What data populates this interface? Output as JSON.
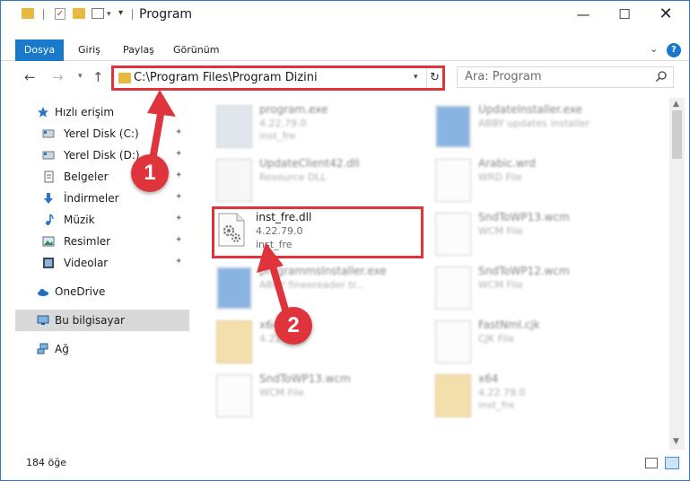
{
  "window": {
    "title": "Program",
    "minimize": "—",
    "maximize": "☐",
    "close": "✕"
  },
  "ribbon": {
    "tabs": [
      "Dosya",
      "Giriş",
      "Paylaş",
      "Görünüm"
    ],
    "help": "?",
    "expand": "⌄"
  },
  "nav": {
    "back": "←",
    "forward": "→",
    "recent": "▾",
    "up": "↑",
    "address": "C:\\Program Files\\Program Dizini",
    "address_dropdown": "▾",
    "refresh": "↻",
    "search_placeholder": "Ara: Program"
  },
  "sidebar": {
    "items": [
      {
        "label": "Hızlı erişim",
        "icon": "star-icon"
      },
      {
        "label": "Yerel Disk (C:)",
        "icon": "drive-icon",
        "pinned": true
      },
      {
        "label": "Yerel Disk (D:)",
        "icon": "drive-icon",
        "pinned": true
      },
      {
        "label": "Belgeler",
        "icon": "documents-icon",
        "pinned": true
      },
      {
        "label": "İndirmeler",
        "icon": "download-icon",
        "pinned": true
      },
      {
        "label": "Müzik",
        "icon": "music-icon",
        "pinned": true
      },
      {
        "label": "Resimler",
        "icon": "pictures-icon",
        "pinned": true
      },
      {
        "label": "Videolar",
        "icon": "video-icon",
        "pinned": true
      },
      {
        "label": "OneDrive",
        "icon": "cloud-icon"
      },
      {
        "label": "Bu bilgisayar",
        "icon": "computer-icon",
        "selected": true
      },
      {
        "label": "Ağ",
        "icon": "network-icon"
      }
    ],
    "pin_glyph": "📌"
  },
  "files": [
    {
      "name": "program.exe",
      "line2": "4.22.79.0",
      "line3": "inst_fre",
      "icon": "exe-icon"
    },
    {
      "name": "UpdateInstaller.exe",
      "line2": "ABBY updates installer",
      "line3": "",
      "icon": "installer-icon"
    },
    {
      "name": "UpdateClient42.dll",
      "line2": "Resource DLL",
      "line3": "",
      "icon": "dll-icon"
    },
    {
      "name": "Arabic.wrd",
      "line2": "WRD File",
      "line3": "",
      "icon": "file-icon"
    },
    {
      "name": "inst_fre.dll",
      "line2": "4.22.79.0",
      "line3": "inst_fre",
      "icon": "dll-gear-icon"
    },
    {
      "name": "SndToWP13.wcm",
      "line2": "WCM File",
      "line3": "",
      "icon": "file-icon"
    },
    {
      "name": "programmsInstaller.exe",
      "line2": "ABBY fineereader tr...",
      "line3": "",
      "icon": "installer-icon"
    },
    {
      "name": "SndToWP12.wcm",
      "line2": "WCM File",
      "line3": "",
      "icon": "file-icon"
    },
    {
      "name": "x64",
      "line2": "4.22.79.0",
      "line3": "",
      "icon": "folder-zip-icon"
    },
    {
      "name": "FastNml.cjk",
      "line2": "CJK File",
      "line3": "",
      "icon": "file-icon"
    },
    {
      "name": "SndToWP13.wcm",
      "line2": "WCM File",
      "line3": "",
      "icon": "file-icon"
    },
    {
      "name": "x64",
      "line2": "4.22.79.0",
      "line3": "inst_fre",
      "icon": "folder-zip-icon"
    }
  ],
  "status": {
    "count": "184 öğe"
  },
  "annotations": {
    "badge1": "1",
    "badge2": "2"
  },
  "colors": {
    "accent": "#1979ca",
    "highlight": "#e0343c",
    "folder": "#e8b93f"
  }
}
